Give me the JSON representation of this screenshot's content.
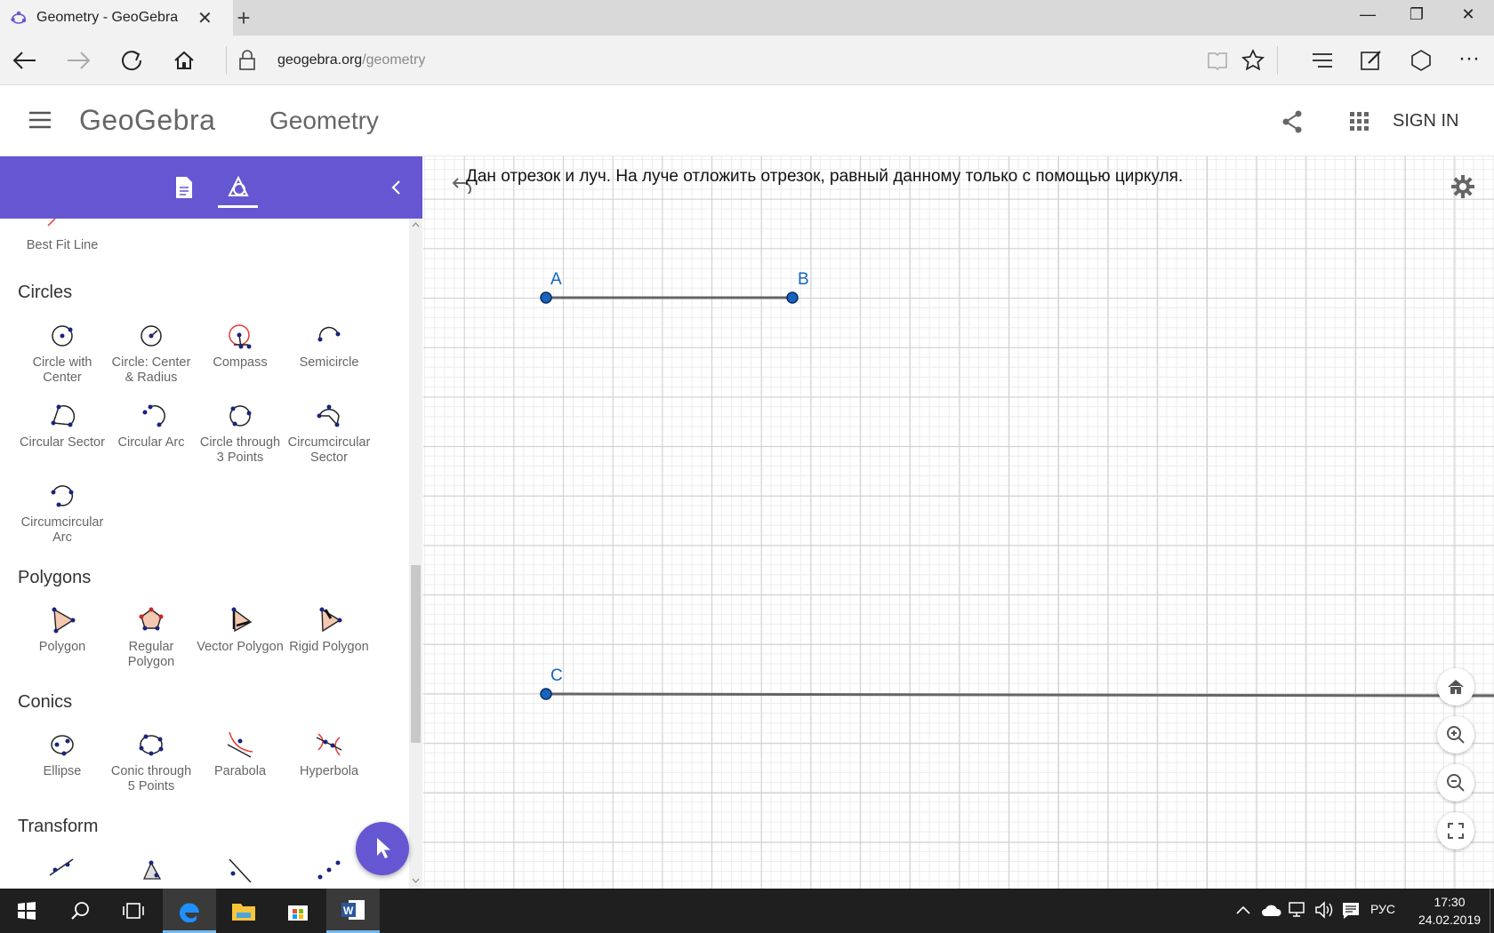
{
  "browser": {
    "tab_title": "Geometry - GeoGebra",
    "url_host": "geogebra.org",
    "url_path": "/geometry",
    "tab_close": "✕",
    "new_tab": "+"
  },
  "header": {
    "logo": "GeoGebra",
    "app_title": "Geometry",
    "sign_in": "SIGN IN"
  },
  "sidebar": {
    "partial_tool": "Best Fit Line",
    "categories": [
      {
        "name": "Circles",
        "tools": [
          "Circle with Center",
          "Circle: Center & Radius",
          "Compass",
          "Semicircle",
          "Circular Sector",
          "Circular Arc",
          "Circle through 3 Points",
          "Circumcircular Sector",
          "Circumcircular Arc"
        ]
      },
      {
        "name": "Polygons",
        "tools": [
          "Polygon",
          "Regular Polygon",
          "Vector Polygon",
          "Rigid Polygon"
        ]
      },
      {
        "name": "Conics",
        "tools": [
          "Ellipse",
          "Conic through 5 Points",
          "Parabola",
          "Hyperbola"
        ]
      },
      {
        "name": "Transform",
        "tools": []
      }
    ]
  },
  "graphics": {
    "task_text": "Дан отрезок и луч. На луче отложить отрезок, равный данному только с помощью циркуля.",
    "points": {
      "A": "A",
      "B": "B",
      "C": "C"
    },
    "point_color": "#1565c0"
  },
  "taskbar": {
    "lang": "РУС",
    "time": "17:30",
    "date": "24.02.2019"
  },
  "colors": {
    "accent": "#6557d2"
  }
}
